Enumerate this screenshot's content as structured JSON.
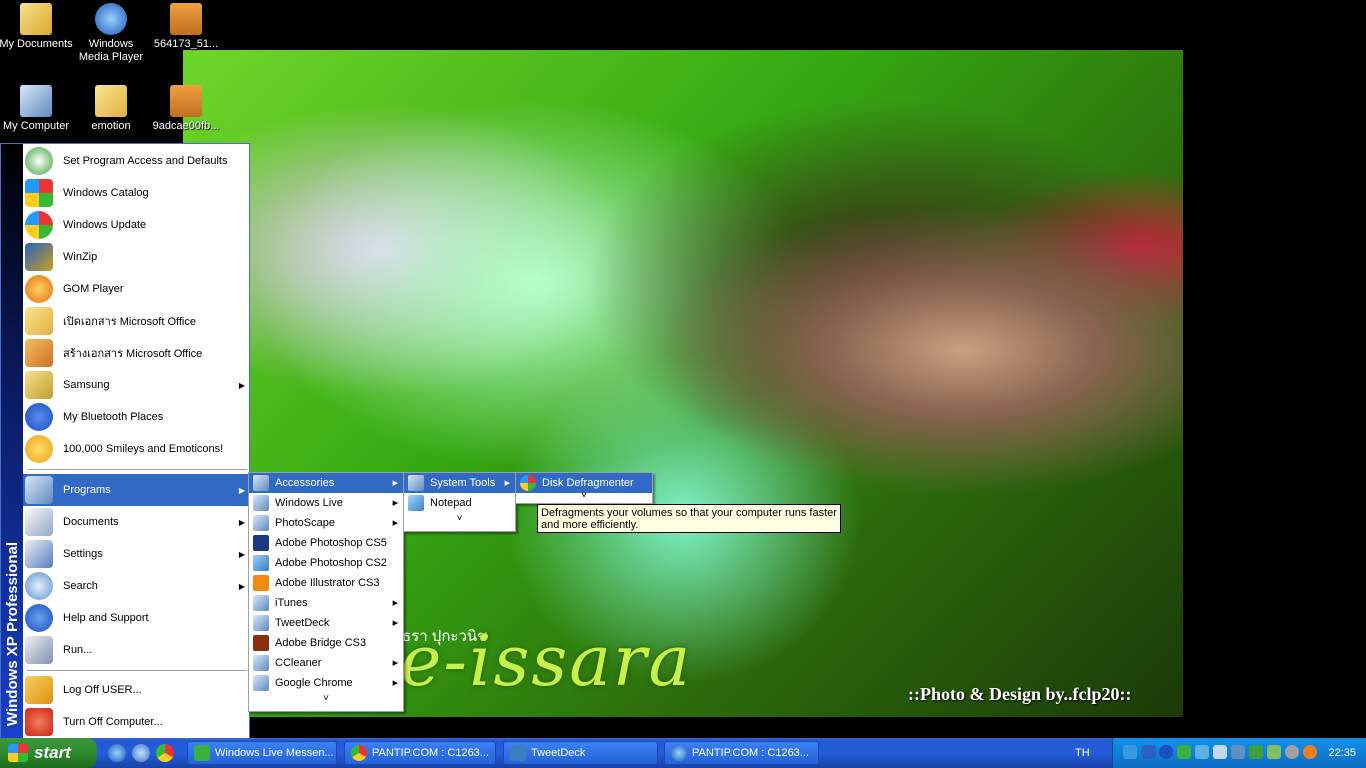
{
  "desktop": {
    "icons": [
      {
        "label": "My Documents",
        "icon": "folder-documents-icon"
      },
      {
        "label": "Windows Media Player",
        "icon": "media-player-icon"
      },
      {
        "label": "564173_51...",
        "icon": "jpg-file-icon"
      },
      {
        "label": "My Computer",
        "icon": "computer-icon"
      },
      {
        "label": "emotion",
        "icon": "folder-icon"
      },
      {
        "label": "9adcae00fb...",
        "icon": "jpg-file-icon"
      }
    ],
    "wallpaper": {
      "thai_text": "ธรา ปุกะวนิช",
      "title_text": "e-issara",
      "credit_text": "::Photo & Design by..fclp20::"
    }
  },
  "start_menu": {
    "brand_prefix": "Windows XP",
    "brand_suffix": "Professional",
    "pinned": [
      {
        "label": "Set Program Access and Defaults",
        "color": "#3aa33a"
      },
      {
        "label": "Windows Catalog",
        "color": "#2a6cd8"
      },
      {
        "label": "Windows Update",
        "color": "#3a8de0"
      },
      {
        "label": "WinZip",
        "color": "#c8a020"
      },
      {
        "label": "GOM Player",
        "color": "#f08a10"
      },
      {
        "label": "เปิดเอกสาร Microsoft Office",
        "color": "#e0b040"
      },
      {
        "label": "สร้างเอกสาร Microsoft Office",
        "color": "#d07020"
      },
      {
        "label": "Samsung",
        "color": "#c0a030"
      },
      {
        "label": "My Bluetooth Places",
        "color": "#1a4fbf"
      },
      {
        "label": "100,000 Smileys and Emoticons!",
        "color": "#f0a020"
      }
    ],
    "programs_label": "Programs",
    "documents_label": "Documents",
    "settings_label": "Settings",
    "search_label": "Search",
    "help_label": "Help and Support",
    "run_label": "Run...",
    "logoff_label": "Log Off USER...",
    "turnoff_label": "Turn Off Computer..."
  },
  "programs_menu": {
    "items": [
      {
        "label": "Accessories",
        "color": "#c8a040"
      },
      {
        "label": "Windows Live",
        "color": "#c8a040"
      },
      {
        "label": "PhotoScape",
        "color": "#c8a040"
      },
      {
        "label": "Adobe Photoshop CS5",
        "color": "#1d3a80"
      },
      {
        "label": "Adobe Photoshop CS2",
        "color": "#3a7ac0"
      },
      {
        "label": "Adobe Illustrator CS3",
        "color": "#f08a10"
      },
      {
        "label": "iTunes",
        "color": "#c8a040"
      },
      {
        "label": "TweetDeck",
        "color": "#c8a040"
      },
      {
        "label": "Adobe Bridge CS3",
        "color": "#8a3010"
      },
      {
        "label": "CCleaner",
        "color": "#c8a040"
      },
      {
        "label": "Google Chrome",
        "color": "#c8a040"
      }
    ],
    "more": "˅"
  },
  "accessories_menu": {
    "system_tools": "System Tools",
    "notepad": "Notepad",
    "more": "˅"
  },
  "system_tools_menu": {
    "disk_defrag": "Disk Defragmenter",
    "more": "˅"
  },
  "tooltip": {
    "text": "Defragments your volumes so that your computer runs faster and more efficiently."
  },
  "taskbar": {
    "start_label": "start",
    "tasks": [
      {
        "label": "Windows Live Messen...",
        "color": "#3ab040"
      },
      {
        "label": "PANTIP.COM : C1263...",
        "color": "#e04030"
      },
      {
        "label": "TweetDeck",
        "color": "#3a80c0"
      },
      {
        "label": "PANTIP.COM : C1263...",
        "color": "#3a80e0"
      }
    ],
    "language": "TH",
    "clock": "22:35"
  }
}
